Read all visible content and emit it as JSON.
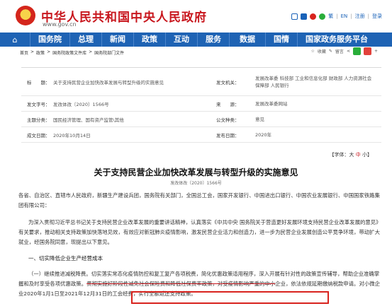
{
  "header": {
    "site_title": "中华人民共和国中央人民政府",
    "site_url": "www.gov.cn",
    "links": [
      "繁",
      "EN",
      "注册",
      "登录"
    ],
    "link_separator": "|",
    "brand_color": "#c8161d",
    "nav_color": "#1e63b4"
  },
  "nav": {
    "home_icon": "home-icon",
    "items": [
      "国务院",
      "总理",
      "新闻",
      "政策",
      "互动",
      "服务",
      "数据",
      "国情",
      "国家政务服务平台"
    ]
  },
  "breadcrumb": [
    "首页",
    ">",
    "政策",
    ">",
    "国务院政策文件库",
    ">",
    "国务院部门文件"
  ],
  "tools": {
    "favorite": "收藏",
    "print": "留言",
    "icons": [
      "share-icon",
      "wechat-icon",
      "weibo-icon"
    ]
  },
  "info": {
    "title_label": "标　　题：",
    "title_value": "关于支持民营企业加快改革发展与转型升级的实施意见",
    "issuer_label": "发文机关：",
    "issuer_value": "发展改革委 科技部 工业和信息化部 财政部 人力资源社会保障部 人民银行",
    "docno_label": "发文字号：",
    "docno_value": "发改体改〔2020〕1566号",
    "source_label": "来　　源：",
    "source_value": "发展改革委网站",
    "topic_label": "主题分类：",
    "topic_value": "国民经济管理、国有资产监管\\其他",
    "type_label": "公文种类：",
    "type_value": "意见",
    "date_label": "成文日期：",
    "date_value": "2020年10月14日",
    "pubdate_label": "发布日期：",
    "pubdate_value": "2020年"
  },
  "fontsize": {
    "prefix": "【字体：",
    "large": "大",
    "medium": "中",
    "small": "小",
    "suffix": "】"
  },
  "doc": {
    "title": "关于支持民营企业加快改革发展与转型升级的实施意见",
    "number": "发改体改〔2020〕1566号",
    "p1": "各省、自治区、直辖市人民政府，新疆生产建设兵团，国务院有关部门，全国总工会，国家开发银行、中国进出口银行、中国农业发展银行、中国国家铁路集团有限公司：",
    "p2": "为深入贯彻习近平总书记关于支持民营企业改革发展的重要讲话精神，认真落实《中共中央 国务院关于营造更好发展环境支持民营企业改革发展的意见》有关要求，推动相关支持政策加快落地见效，有效应对新冠肺炎疫情影响，激发民营企业活力和创造力，进一步为民营企业发展创造公平竞争环境，带动扩大就业，经国务院同意，现提出以下意见。",
    "section1": "一、切实降低企业生产经营成本",
    "p3_a": "（一）继续推进减税降费。切实落实常态化疫情防控和复工复产各项税费，简化优惠政策适用程序，深入开展有针对性的政策宣传辅导，帮助企业准确掌握和及时享受各项优惠政策。",
    "p3_strike": "贯彻实施好阶段性减免社会保险费和降低社保费率政策，对受疫情影响严重的中小",
    "p3_b": "企业，依法依规延期缴纳税款申请。",
    "p3_highlight": "对小微企业2020年1月1日至2021年12月31日的工会经费，实行全额返还支持政策。"
  }
}
